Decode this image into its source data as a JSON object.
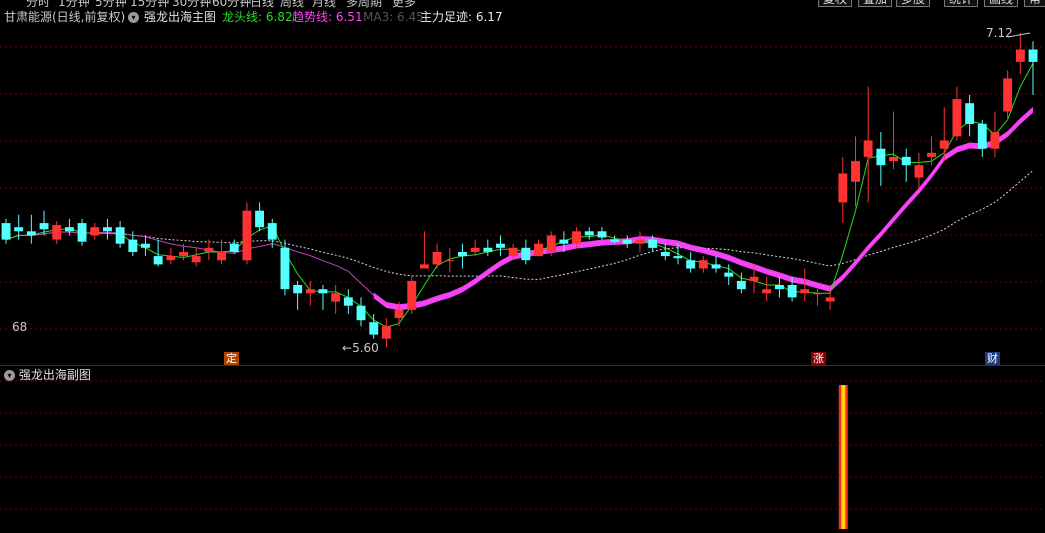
{
  "toolbar": {
    "period_tabs": [
      "分时",
      "1分钟",
      "5分钟",
      "15分钟",
      "30分钟",
      "60分钟",
      "日线",
      "周线",
      "月线",
      "多周期",
      "更多"
    ],
    "buttons": [
      "复权",
      "叠加",
      "多股",
      "统计",
      "画线",
      "帮"
    ]
  },
  "header": {
    "stock_title": "甘肃能源(日线,前复权)",
    "indicator_name": "强龙出海主图",
    "dragon_head_label": "龙头线: 6.82",
    "trend_label": "趋势线: 6.51",
    "ma3_label": "MA3: 6.45",
    "main_force_label": "主力足迹: 6.17"
  },
  "price_axis": {
    "left_value": "68"
  },
  "annotations": {
    "high_label": "7.12",
    "low_label": "5.60",
    "ding_marker": "定",
    "zhang_marker": "涨",
    "cai_marker": "财"
  },
  "sub_chart": {
    "title": "强龙出海副图"
  },
  "colors": {
    "up": "#ff3333",
    "down": "#54ffff",
    "dragon_head": "#22dd22",
    "trend": "#ff33ff",
    "ma3": "#d8d8d8",
    "main_force": "#ff44ff",
    "grid": "#7a0000"
  },
  "chart_data": {
    "type": "candlestick",
    "ohlc": [
      [
        6.2,
        6.22,
        6.1,
        6.12
      ],
      [
        6.18,
        6.24,
        6.12,
        6.16
      ],
      [
        6.16,
        6.24,
        6.1,
        6.14
      ],
      [
        6.2,
        6.26,
        6.14,
        6.17
      ],
      [
        6.12,
        6.21,
        6.1,
        6.19
      ],
      [
        6.18,
        6.22,
        6.14,
        6.16
      ],
      [
        6.2,
        6.22,
        6.09,
        6.11
      ],
      [
        6.14,
        6.2,
        6.12,
        6.18
      ],
      [
        6.18,
        6.22,
        6.12,
        6.16
      ],
      [
        6.18,
        6.21,
        6.08,
        6.1
      ],
      [
        6.12,
        6.16,
        6.04,
        6.06
      ],
      [
        6.1,
        6.14,
        6.04,
        6.08
      ],
      [
        6.04,
        6.12,
        5.99,
        6.0
      ],
      [
        6.02,
        6.08,
        6.0,
        6.04
      ],
      [
        6.04,
        6.1,
        6.02,
        6.06
      ],
      [
        6.01,
        6.08,
        5.99,
        6.04
      ],
      [
        6.06,
        6.12,
        6.02,
        6.08
      ],
      [
        6.02,
        6.12,
        6.0,
        6.06
      ],
      [
        6.1,
        6.12,
        6.05,
        6.06
      ],
      [
        6.02,
        6.3,
        6.0,
        6.26
      ],
      [
        6.26,
        6.3,
        6.16,
        6.18
      ],
      [
        6.2,
        6.22,
        6.08,
        6.12
      ],
      [
        6.08,
        6.12,
        5.85,
        5.88
      ],
      [
        5.9,
        5.92,
        5.78,
        5.86
      ],
      [
        5.86,
        5.92,
        5.8,
        5.88
      ],
      [
        5.88,
        5.9,
        5.78,
        5.86
      ],
      [
        5.82,
        5.9,
        5.76,
        5.86
      ],
      [
        5.84,
        5.88,
        5.76,
        5.8
      ],
      [
        5.8,
        5.84,
        5.7,
        5.73
      ],
      [
        5.72,
        5.76,
        5.64,
        5.66
      ],
      [
        5.64,
        5.74,
        5.6,
        5.7
      ],
      [
        5.74,
        5.82,
        5.7,
        5.78
      ],
      [
        5.78,
        5.94,
        5.76,
        5.92
      ],
      [
        5.98,
        6.16,
        5.98,
        6.0
      ],
      [
        6.0,
        6.1,
        5.98,
        6.06
      ],
      [
        6.02,
        6.08,
        5.96,
        6.02
      ],
      [
        6.06,
        6.1,
        5.98,
        6.04
      ],
      [
        6.06,
        6.12,
        6.04,
        6.08
      ],
      [
        6.08,
        6.12,
        6.04,
        6.06
      ],
      [
        6.1,
        6.14,
        6.04,
        6.08
      ],
      [
        6.04,
        6.1,
        6.02,
        6.08
      ],
      [
        6.08,
        6.12,
        6.0,
        6.02
      ],
      [
        6.04,
        6.12,
        6.04,
        6.1
      ],
      [
        6.06,
        6.16,
        6.04,
        6.14
      ],
      [
        6.12,
        6.16,
        6.06,
        6.1
      ],
      [
        6.1,
        6.18,
        6.08,
        6.16
      ],
      [
        6.16,
        6.18,
        6.12,
        6.14
      ],
      [
        6.16,
        6.18,
        6.12,
        6.13
      ],
      [
        6.12,
        6.14,
        6.1,
        6.11
      ],
      [
        6.12,
        6.14,
        6.08,
        6.1
      ],
      [
        6.1,
        6.16,
        6.06,
        6.12
      ],
      [
        6.12,
        6.14,
        6.06,
        6.08
      ],
      [
        6.06,
        6.1,
        6.02,
        6.04
      ],
      [
        6.04,
        6.1,
        6.0,
        6.03
      ],
      [
        6.02,
        6.06,
        5.96,
        5.98
      ],
      [
        5.98,
        6.04,
        5.96,
        6.02
      ],
      [
        6.0,
        6.04,
        5.96,
        5.98
      ],
      [
        5.96,
        6.0,
        5.9,
        5.94
      ],
      [
        5.92,
        5.96,
        5.86,
        5.88
      ],
      [
        5.92,
        6.0,
        5.86,
        5.94
      ],
      [
        5.86,
        5.94,
        5.82,
        5.88
      ],
      [
        5.9,
        5.94,
        5.84,
        5.88
      ],
      [
        5.9,
        5.94,
        5.82,
        5.84
      ],
      [
        5.86,
        5.98,
        5.82,
        5.88
      ],
      [
        5.86,
        5.88,
        5.8,
        5.86
      ],
      [
        5.82,
        5.88,
        5.78,
        5.84
      ],
      [
        6.3,
        6.52,
        6.2,
        6.44
      ],
      [
        6.4,
        6.62,
        6.28,
        6.5
      ],
      [
        6.52,
        6.86,
        6.3,
        6.6
      ],
      [
        6.56,
        6.64,
        6.38,
        6.48
      ],
      [
        6.5,
        6.74,
        6.46,
        6.52
      ],
      [
        6.52,
        6.56,
        6.4,
        6.48
      ],
      [
        6.42,
        6.54,
        6.36,
        6.48
      ],
      [
        6.52,
        6.62,
        6.48,
        6.54
      ],
      [
        6.56,
        6.76,
        6.5,
        6.6
      ],
      [
        6.62,
        6.86,
        6.6,
        6.8
      ],
      [
        6.78,
        6.82,
        6.62,
        6.68
      ],
      [
        6.68,
        6.7,
        6.52,
        6.56
      ],
      [
        6.56,
        6.74,
        6.52,
        6.64
      ],
      [
        6.74,
        6.94,
        6.7,
        6.9
      ],
      [
        6.98,
        7.12,
        6.92,
        7.04
      ],
      [
        7.04,
        7.08,
        6.82,
        6.98
      ]
    ],
    "high": 7.12,
    "low": 5.6,
    "signal_bar_index": 66
  }
}
